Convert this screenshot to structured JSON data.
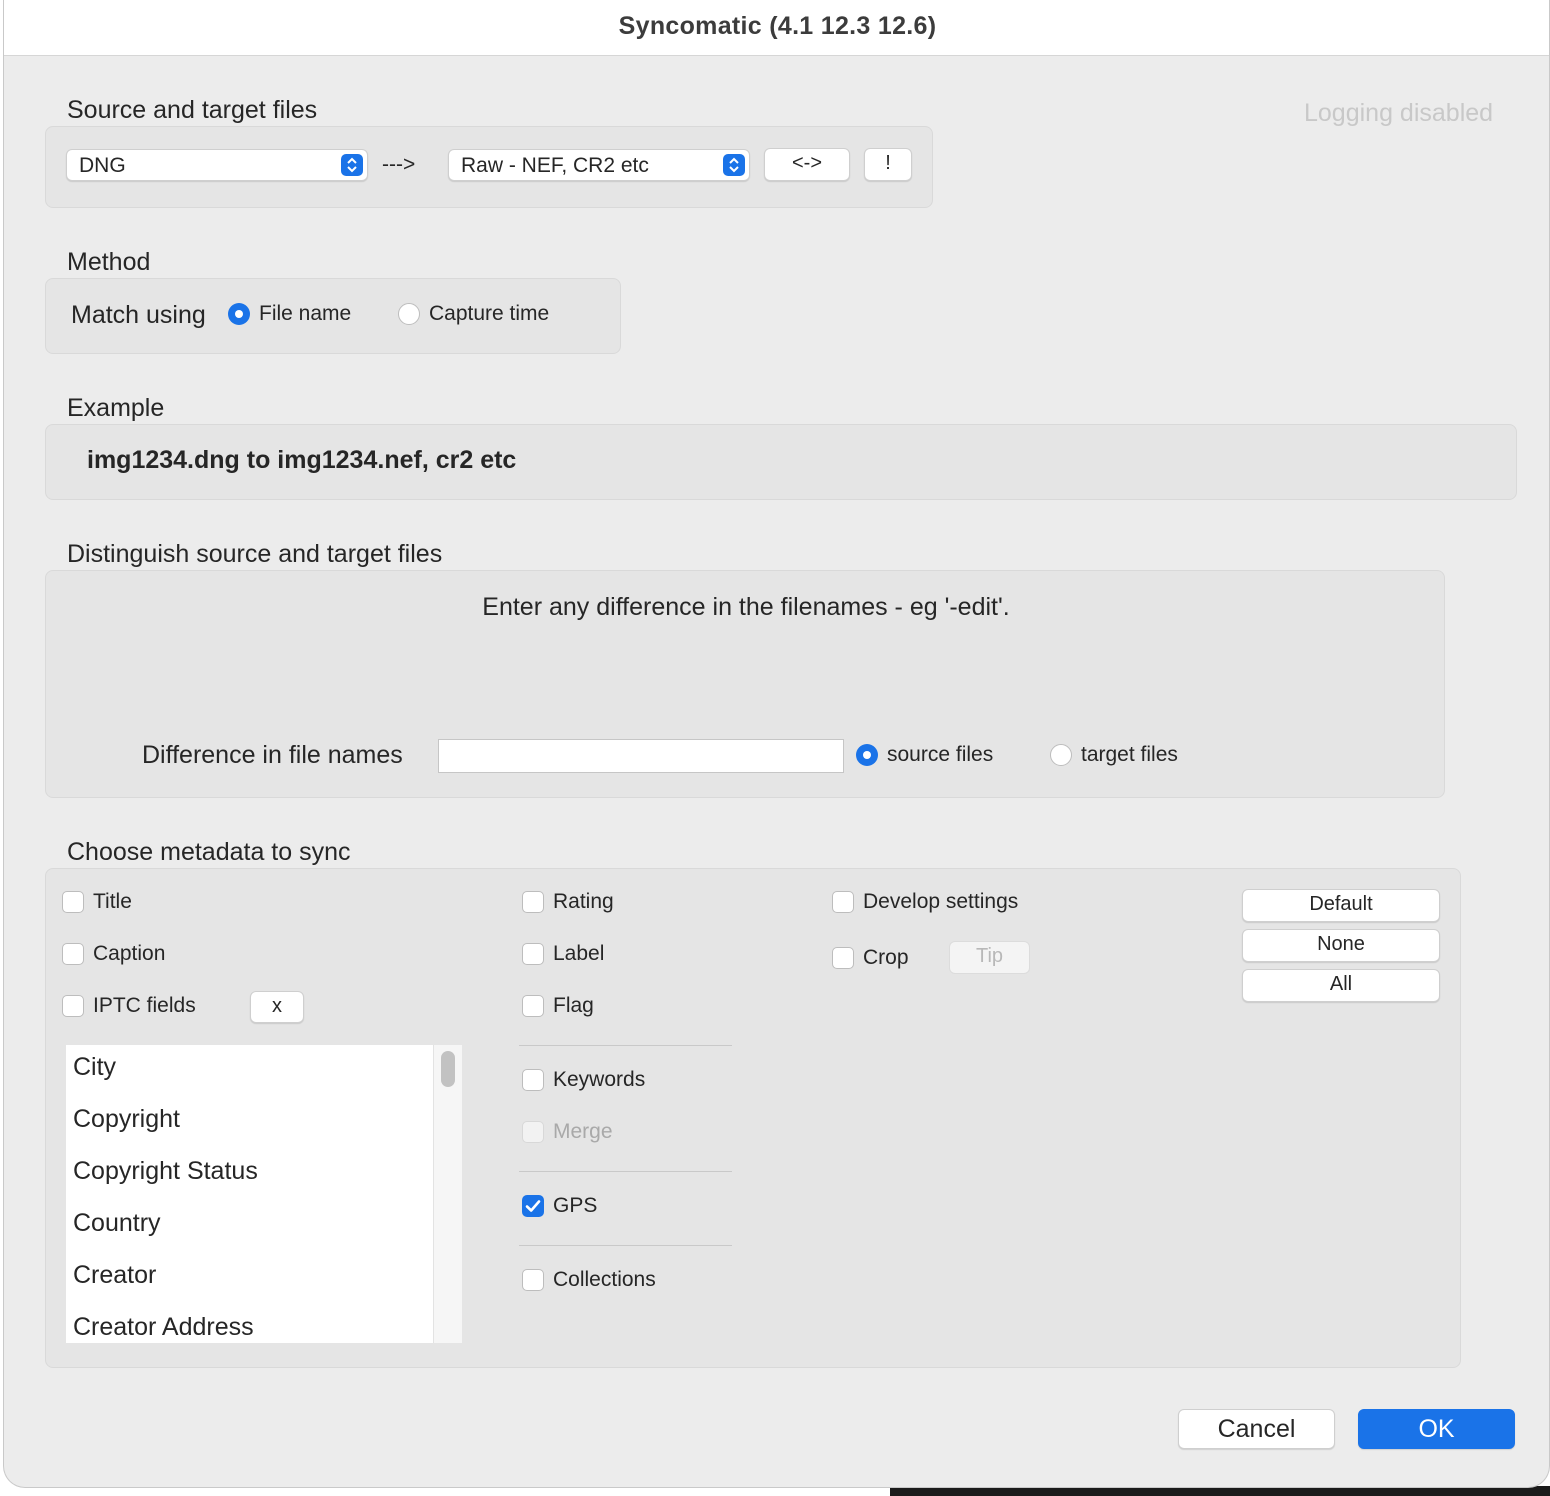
{
  "window": {
    "title": "Syncomatic  (4.1 12.3 12.6)"
  },
  "logging_status": "Logging disabled",
  "source_target": {
    "label": "Source and target files",
    "source_value": "DNG",
    "arrow_text": "--->",
    "target_value": "Raw - NEF, CR2 etc",
    "swap_label": "<->",
    "bang_label": "!"
  },
  "method": {
    "label": "Method",
    "match_label": "Match using",
    "options": [
      "File name",
      "Capture time"
    ],
    "selected": "File name"
  },
  "example": {
    "label": "Example",
    "text": "img1234.dng to img1234.nef, cr2 etc"
  },
  "distinguish": {
    "label": "Distinguish source and target files",
    "hint": "Enter any difference in the filenames - eg '-edit'.",
    "field_label": "Difference in file names",
    "field_value": "",
    "options": [
      "source files",
      "target files"
    ],
    "selected": "source files"
  },
  "metadata": {
    "label": "Choose metadata to sync",
    "col1": [
      {
        "label": "Title",
        "checked": false
      },
      {
        "label": "Caption",
        "checked": false
      },
      {
        "label": "IPTC fields",
        "checked": false
      }
    ],
    "iptc_clear_label": "x",
    "iptc_list": [
      "City",
      "Copyright",
      "Copyright Status",
      "Country",
      "Creator",
      "Creator Address"
    ],
    "col2": [
      {
        "label": "Rating",
        "checked": false
      },
      {
        "label": "Label",
        "checked": false
      },
      {
        "label": "Flag",
        "checked": false
      },
      {
        "label": "Keywords",
        "checked": false
      },
      {
        "label": "Merge",
        "checked": false,
        "disabled": true
      },
      {
        "label": "GPS",
        "checked": true
      },
      {
        "label": "Collections",
        "checked": false
      }
    ],
    "col3": [
      {
        "label": "Develop settings",
        "checked": false
      },
      {
        "label": "Crop",
        "checked": false
      }
    ],
    "tip_label": "Tip",
    "preset_buttons": [
      "Default",
      "None",
      "All"
    ]
  },
  "footer": {
    "cancel_label": "Cancel",
    "ok_label": "OK"
  },
  "colors": {
    "accent": "#1a73e8",
    "panel": "#e5e5e5",
    "window": "#ececec"
  }
}
